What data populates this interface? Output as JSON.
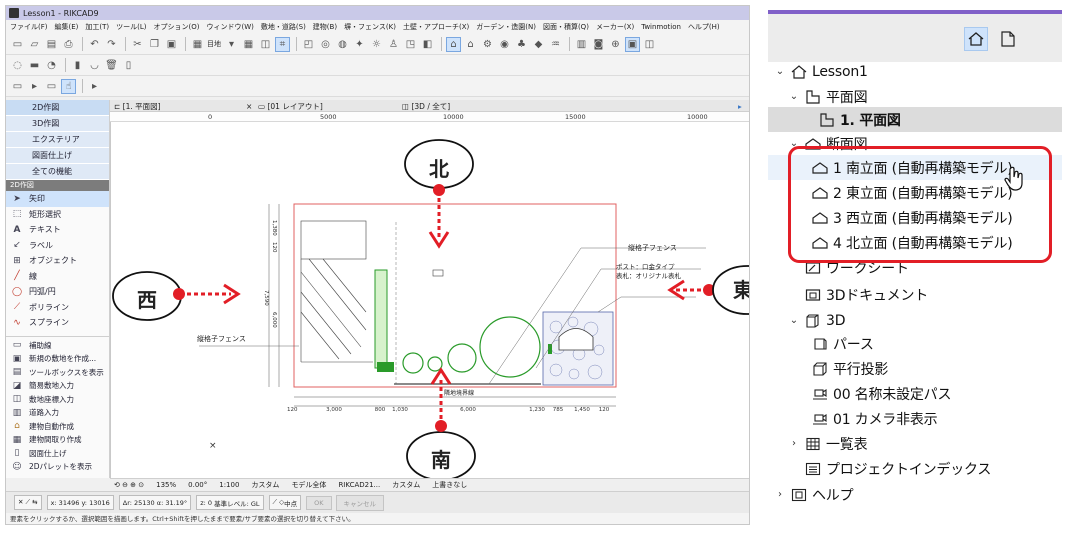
{
  "window": {
    "title": "Lesson1 - RIKCAD9"
  },
  "menubar": [
    "ファイル(F)",
    "編集(E)",
    "加工(T)",
    "ツール(L)",
    "オプション(O)",
    "ウィンドウ(W)",
    "敷地・道路(S)",
    "建物(B)",
    "塀・フェンス(K)",
    "土壁・アプローチ(X)",
    "ガーデン・造園(N)",
    "図面・積算(Q)",
    "メーカー(X)",
    "Twinmotion",
    "ヘルプ(H)"
  ],
  "toolbar": {
    "dropdown_label": "目地"
  },
  "palette": {
    "categories": [
      "2D作図",
      "3D作図",
      "エクステリア",
      "図面仕上げ",
      "全ての機能"
    ],
    "section_header": "2D作図",
    "items": [
      {
        "icon": "arrow-pointer-icon",
        "label": "矢印"
      },
      {
        "icon": "marquee-select-icon",
        "label": "矩形選択"
      },
      {
        "icon": "text-tool-icon",
        "label": "テキスト"
      },
      {
        "icon": "label-tool-icon",
        "label": "ラベル"
      },
      {
        "icon": "object-tool-icon",
        "label": "オブジェクト"
      },
      {
        "icon": "line-tool-icon",
        "label": "線"
      },
      {
        "icon": "circle-arc-icon",
        "label": "円弧/円"
      },
      {
        "icon": "polyline-icon",
        "label": "ポリライン"
      },
      {
        "icon": "spline-icon",
        "label": "スプライン"
      }
    ],
    "extra_items": [
      {
        "icon": "guide-line-icon",
        "label": "補助線"
      },
      {
        "icon": "new-site-icon",
        "label": "新規の敷地を作成..."
      },
      {
        "icon": "toolbox-icon",
        "label": "ツールボックスを表示"
      },
      {
        "icon": "simple-site-icon",
        "label": "簡易敷地入力"
      },
      {
        "icon": "site-coordinates-icon",
        "label": "敷地座標入力"
      },
      {
        "icon": "road-icon",
        "label": "道路入力"
      },
      {
        "icon": "building-auto-icon",
        "label": "建物自動作成"
      },
      {
        "icon": "building-layout-icon",
        "label": "建物間取り作成"
      },
      {
        "icon": "drawing-finish-icon",
        "label": "図面仕上げ"
      },
      {
        "icon": "palette-show-icon",
        "label": "2Dパレットを表示"
      }
    ]
  },
  "tabs": [
    {
      "label": "[1. 平面図]",
      "close": "×"
    },
    {
      "label": "[01 レイアウト]"
    },
    {
      "label": "[3D / 全て]"
    }
  ],
  "ruler": {
    "marks": [
      "0",
      "5000",
      "10000",
      "15000",
      "10000"
    ]
  },
  "drawing": {
    "compass": {
      "north": "北",
      "south": "南",
      "west": "西",
      "east": "東"
    },
    "labels": {
      "fence_top_right": "縦格子フェンス",
      "post_note": "ポスト：口金タイプ",
      "sign_note": "表札：オリジナル表札",
      "fence_left": "縦格子フェンス",
      "boundary": "隣地境界線"
    },
    "dims_bottom": [
      "120",
      "3,000",
      "800",
      "1,030",
      "6,000",
      "1,230",
      "785",
      "1,450",
      "120"
    ],
    "dims_left": [
      "1,380",
      "120",
      "7,590",
      "6,000"
    ]
  },
  "statusbar": {
    "zoom": "135%",
    "angle": "0.00°",
    "scale": "1:100",
    "custom1": "カスタム",
    "model": "モデル全体",
    "file": "RIKCAD21...",
    "custom2": "カスタム",
    "overwrite": "上書きなし"
  },
  "infobox": {
    "x": "x: 31496",
    "y": "y: 13016",
    "dx": "Δr: 25130",
    "da": "α: 31.19°",
    "z": "z: 0",
    "ref": "基準レベル: GL",
    "mid": "中点",
    "ok": "OK",
    "cancel": "キャンセル"
  },
  "hint": "要素をクリックするか、選択範囲を描画します。Ctrl+Shiftを押したままで要素/サブ要素の選択を切り替えて下さい。",
  "navigator": {
    "tree": [
      {
        "level": 0,
        "chev": "v",
        "icon": "project-house-icon",
        "label": "Lesson1"
      },
      {
        "level": 1,
        "chev": "v",
        "icon": "floor-plan-folder-icon",
        "label": "平面図"
      },
      {
        "level": 2,
        "chev": "",
        "icon": "floor-plan-icon",
        "label": "1. 平面図",
        "selected": true
      },
      {
        "level": 1,
        "chev": "v",
        "icon": "section-folder-icon",
        "label": "断面図"
      },
      {
        "level": 2,
        "chev": "",
        "icon": "elevation-icon",
        "label": "1 南立面 (自動再構築モデル)",
        "hover": true
      },
      {
        "level": 2,
        "chev": "",
        "icon": "elevation-icon",
        "label": "2 東立面 (自動再構築モデル)"
      },
      {
        "level": 2,
        "chev": "",
        "icon": "elevation-icon",
        "label": "3 西立面 (自動再構築モデル)"
      },
      {
        "level": 2,
        "chev": "",
        "icon": "elevation-icon",
        "label": "4 北立面 (自動再構築モデル)"
      },
      {
        "level": 1,
        "chev": "",
        "icon": "worksheet-icon",
        "label": "ワークシート"
      },
      {
        "level": 1,
        "chev": "",
        "icon": "3d-document-icon",
        "label": "3Dドキュメント"
      },
      {
        "level": 1,
        "chev": "v",
        "icon": "3d-cube-icon",
        "label": "3D"
      },
      {
        "level": 2,
        "chev": "",
        "icon": "perspective-icon",
        "label": "パース"
      },
      {
        "level": 2,
        "chev": "",
        "icon": "parallel-projection-icon",
        "label": "平行投影"
      },
      {
        "level": 2,
        "chev": "",
        "icon": "camera-path-icon",
        "label": "00 名称未設定パス"
      },
      {
        "level": 2,
        "chev": "",
        "icon": "camera-path-icon",
        "label": "01 カメラ非表示"
      },
      {
        "level": 1,
        "chev": ">",
        "icon": "schedule-grid-icon",
        "label": "一覧表"
      },
      {
        "level": 1,
        "chev": "",
        "icon": "project-index-icon",
        "label": "プロジェクトインデックス"
      },
      {
        "level": 0,
        "chev": ">",
        "icon": "help-book-icon",
        "label": "ヘルプ"
      }
    ]
  },
  "colors": {
    "highlight_red": "#e21e26",
    "accent_purple": "#8060c8",
    "selection_blue": "#cfe3fb"
  }
}
